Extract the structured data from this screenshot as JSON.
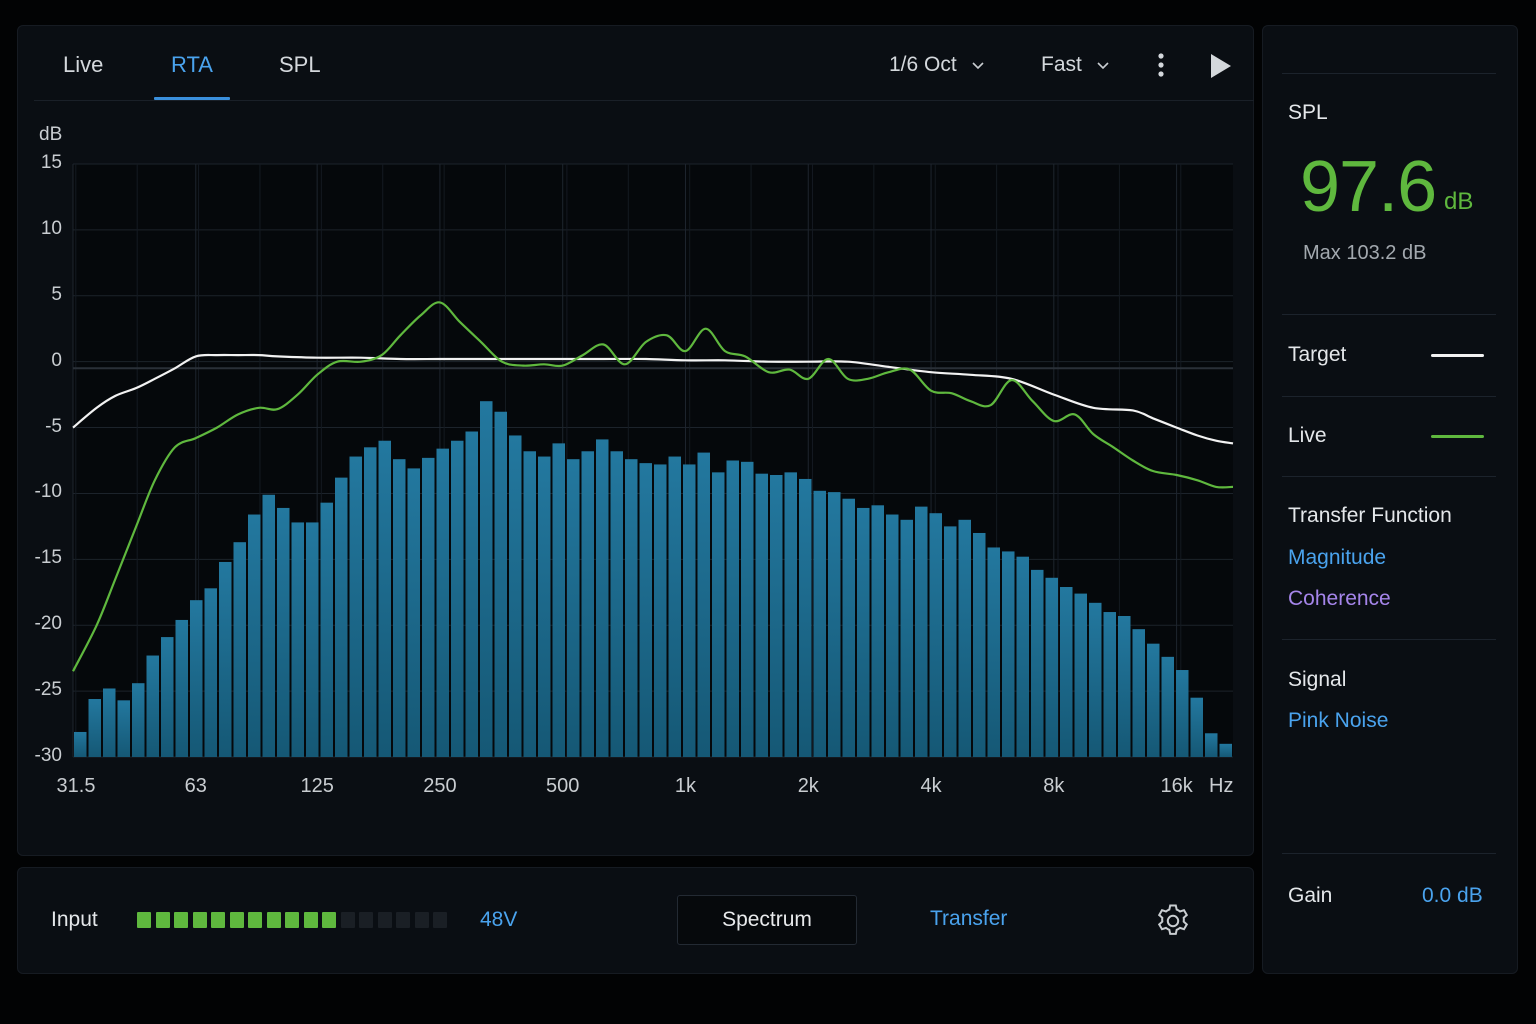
{
  "tabs": [
    {
      "label": "Live"
    },
    {
      "label": "RTA"
    },
    {
      "label": "SPL"
    }
  ],
  "active_tab": "RTA",
  "controls": {
    "resolution_value": "1/6 Oct",
    "speed_value": "Fast"
  },
  "colors": {
    "accent": "#4aa3ee",
    "live": "#5fb83e",
    "target": "#f2f2f2",
    "bars": "#1f6f95",
    "coherence": "#a585ea",
    "background": "#0a0e13"
  },
  "chart_data": {
    "type": "bar",
    "ylabel": "dB",
    "xlabel": "Hz",
    "ylim": [
      -30,
      15
    ],
    "yticks": [
      "15",
      "10",
      "5",
      "0",
      "-5",
      "-10",
      "-15",
      "-20",
      "-25",
      "-30"
    ],
    "xticks": [
      "31.5",
      "63",
      "125",
      "250",
      "500",
      "1k",
      "2k",
      "4k",
      "8k",
      "16k"
    ],
    "x_scale": "log",
    "xlim_hz": [
      31.5,
      22000
    ],
    "grid": true,
    "bar_resolution": "1/6 octave",
    "series": [
      {
        "name": "Live",
        "type": "line",
        "x": [
          31.5,
          36,
          40,
          45,
          50,
          56,
          63,
          71,
          80,
          90,
          100,
          112,
          125,
          140,
          160,
          180,
          200,
          224,
          250,
          280,
          315,
          355,
          400,
          450,
          500,
          560,
          630,
          710,
          800,
          900,
          1000,
          1120,
          1250,
          1400,
          1600,
          1800,
          2000,
          2240,
          2500,
          2800,
          3150,
          3550,
          4000,
          4500,
          5000,
          5600,
          6300,
          7100,
          8000,
          9000,
          10000,
          11200,
          12500,
          14000,
          16000,
          18000,
          20000,
          22000
        ],
        "values": [
          -23.5,
          -20,
          -16.5,
          -12.5,
          -9,
          -6.5,
          -5.8,
          -5,
          -4,
          -3.5,
          -3.6,
          -2.5,
          -1,
          0,
          0.0,
          0.5,
          2,
          3.5,
          4.5,
          3,
          1.5,
          0,
          -0.3,
          -0.2,
          -0.3,
          0.5,
          1.3,
          -0.2,
          1.5,
          2.0,
          0.8,
          2.5,
          0.8,
          0.4,
          -0.8,
          -0.6,
          -1.3,
          0.2,
          -1.3,
          -1.3,
          -0.8,
          -0.6,
          -2.2,
          -2.4,
          -3,
          -3.3,
          -1.4,
          -3,
          -4.5,
          -4.0,
          -5.5,
          -6.5,
          -7.5,
          -8.3,
          -8.6,
          -9.0,
          -9.5,
          -9.5
        ]
      },
      {
        "name": "Target",
        "type": "line",
        "x": [
          31.5,
          36,
          40,
          45,
          50,
          56,
          63,
          71,
          80,
          90,
          100,
          125,
          160,
          200,
          250,
          315,
          400,
          500,
          630,
          800,
          1000,
          1250,
          1600,
          2000,
          2500,
          3150,
          4000,
          5000,
          6300,
          8000,
          10000,
          12500,
          14000,
          16000,
          18000,
          20000,
          22000
        ],
        "values": [
          -5,
          -3.5,
          -2.6,
          -2,
          -1.3,
          -0.5,
          0.4,
          0.5,
          0.5,
          0.5,
          0.4,
          0.3,
          0.3,
          0.2,
          0.2,
          0.2,
          0.2,
          0.2,
          0.2,
          0.2,
          0.1,
          0.1,
          0,
          0,
          0,
          -0.4,
          -0.8,
          -1.0,
          -1.3,
          -2.5,
          -3.5,
          -3.7,
          -4.3,
          -5,
          -5.6,
          -6,
          -6.2
        ]
      },
      {
        "name": "Spectrum",
        "type": "bar",
        "values": [
          -28.1,
          -25.6,
          -24.8,
          -25.7,
          -24.4,
          -22.3,
          -20.9,
          -19.6,
          -18.1,
          -17.2,
          -15.2,
          -13.7,
          -11.6,
          -10.1,
          -11.1,
          -12.2,
          -12.2,
          -10.7,
          -8.8,
          -7.2,
          -6.5,
          -6.0,
          -7.4,
          -8.1,
          -7.3,
          -6.6,
          -6.0,
          -5.3,
          -3.0,
          -3.8,
          -5.6,
          -6.8,
          -7.2,
          -6.2,
          -7.4,
          -6.8,
          -5.9,
          -6.8,
          -7.4,
          -7.7,
          -7.8,
          -7.2,
          -7.8,
          -6.9,
          -8.4,
          -7.5,
          -7.6,
          -8.5,
          -8.6,
          -8.4,
          -8.9,
          -9.8,
          -9.9,
          -10.4,
          -11.1,
          -10.9,
          -11.6,
          -12.0,
          -11.0,
          -11.5,
          -12.5,
          -12.0,
          -13.0,
          -14.1,
          -14.4,
          -14.8,
          -15.8,
          -16.4,
          -17.1,
          -17.6,
          -18.3,
          -19.0,
          -19.3,
          -20.3,
          -21.4,
          -22.4,
          -23.4,
          -25.5,
          -28.2,
          -29.0
        ]
      }
    ]
  },
  "bottom_bar": {
    "input_label": "Input",
    "meter_level": 0.66,
    "phantom_label": "48V",
    "spectrum_label": "Spectrum",
    "transfer_label": "Transfer"
  },
  "side_panel": {
    "spl_label": "SPL",
    "spl_value": "97.6",
    "spl_unit": "dB",
    "max_text": "Max 103.2 dB",
    "target_label": "Target",
    "live_label": "Live",
    "transfer_heading": "Transfer Function",
    "magnitude_label": "Magnitude",
    "coherence_label": "Coherence",
    "signal_heading": "Signal",
    "signal_value": "Pink Noise",
    "gain_label": "Gain",
    "gain_value": "0.0 dB"
  }
}
